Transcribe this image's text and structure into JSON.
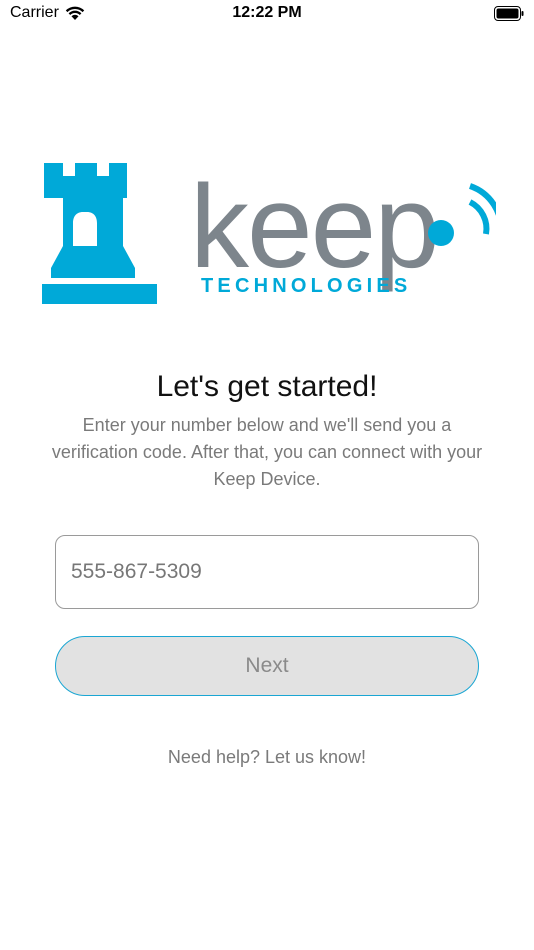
{
  "status_bar": {
    "carrier": "Carrier",
    "time": "12:22 PM"
  },
  "logo": {
    "wordmark": "keep",
    "tagline": "TECHNOLOGIES",
    "brand_colors": {
      "blue": "#00a9d8",
      "gray": "#7d858c"
    }
  },
  "main": {
    "heading": "Let's get started!",
    "description": "Enter your number below and we'll send you a verification code. After that, you can connect with your Keep Device.",
    "phone_input": {
      "placeholder": "555-867-5309",
      "value": ""
    },
    "next_label": "Next",
    "help_text": "Need help? Let us know!"
  },
  "colors": {
    "accent": "#1aa6d3",
    "button_fill": "#e2e2e2",
    "muted_text": "#7a7a7a"
  }
}
